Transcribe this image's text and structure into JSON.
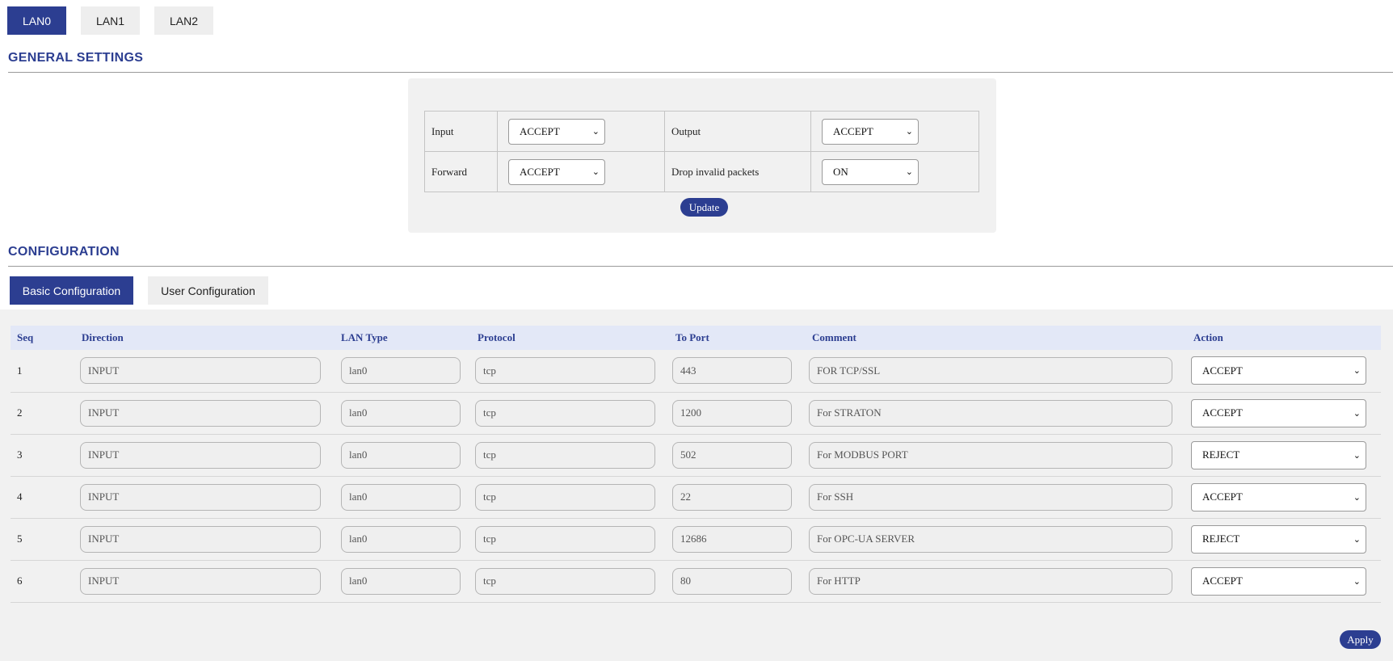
{
  "lan_tabs": [
    "LAN0",
    "LAN1",
    "LAN2"
  ],
  "general": {
    "title": "GENERAL SETTINGS",
    "input_label": "Input",
    "input_value": "ACCEPT",
    "output_label": "Output",
    "output_value": "ACCEPT",
    "forward_label": "Forward",
    "forward_value": "ACCEPT",
    "drop_label": "Drop invalid packets",
    "drop_value": "ON",
    "update_label": "Update"
  },
  "configuration": {
    "title": "CONFIGURATION",
    "tabs": [
      "Basic Configuration",
      "User Configuration"
    ],
    "columns": [
      "Seq",
      "Direction",
      "LAN Type",
      "Protocol",
      "To Port",
      "Comment",
      "Action"
    ],
    "rows": [
      {
        "seq": "1",
        "direction": "INPUT",
        "lan_type": "lan0",
        "protocol": "tcp",
        "port": "443",
        "comment": "FOR TCP/SSL",
        "action": "ACCEPT"
      },
      {
        "seq": "2",
        "direction": "INPUT",
        "lan_type": "lan0",
        "protocol": "tcp",
        "port": "1200",
        "comment": "For STRATON",
        "action": "ACCEPT"
      },
      {
        "seq": "3",
        "direction": "INPUT",
        "lan_type": "lan0",
        "protocol": "tcp",
        "port": "502",
        "comment": "For MODBUS PORT",
        "action": "REJECT"
      },
      {
        "seq": "4",
        "direction": "INPUT",
        "lan_type": "lan0",
        "protocol": "tcp",
        "port": "22",
        "comment": "For SSH",
        "action": "ACCEPT"
      },
      {
        "seq": "5",
        "direction": "INPUT",
        "lan_type": "lan0",
        "protocol": "tcp",
        "port": "12686",
        "comment": "For OPC-UA SERVER",
        "action": "REJECT"
      },
      {
        "seq": "6",
        "direction": "INPUT",
        "lan_type": "lan0",
        "protocol": "tcp",
        "port": "80",
        "comment": "For HTTP",
        "action": "ACCEPT"
      }
    ],
    "apply_label": "Apply"
  },
  "colors": {
    "accent": "#2c3e91",
    "header_bg": "#e3e8f7",
    "panel_bg": "#f1f1f1"
  }
}
